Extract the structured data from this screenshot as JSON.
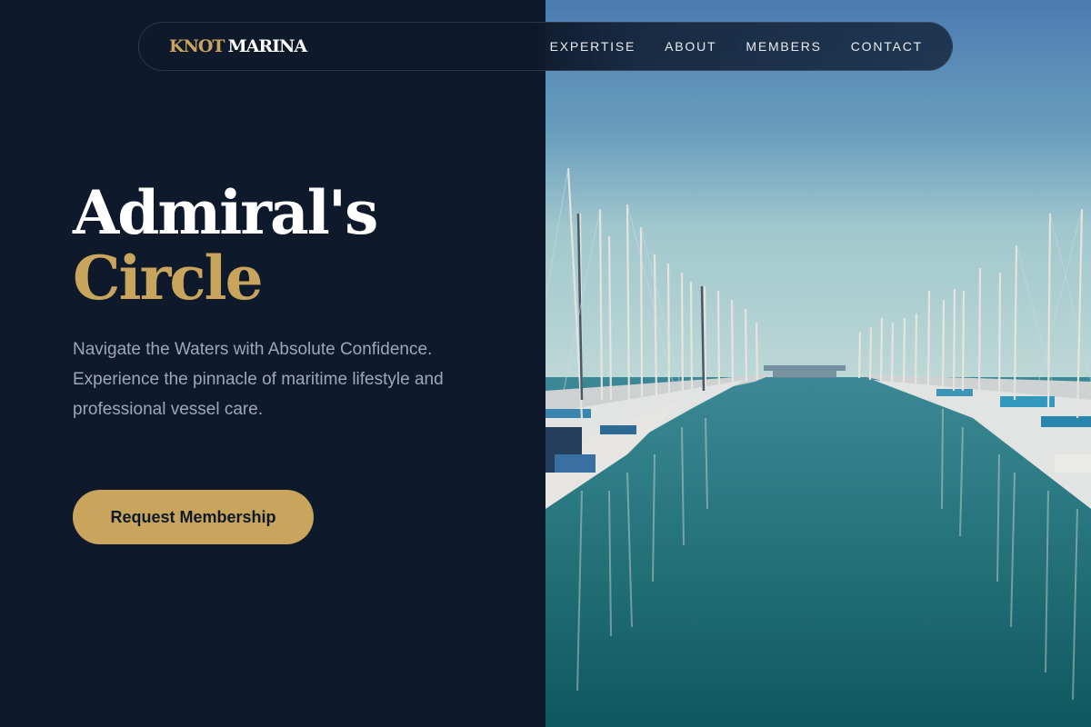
{
  "brand": {
    "part1": "KNOT",
    "part2": "MARINA"
  },
  "nav": {
    "items": [
      {
        "label": "EXPERTISE"
      },
      {
        "label": "ABOUT"
      },
      {
        "label": "MEMBERS"
      },
      {
        "label": "CONTACT"
      }
    ]
  },
  "hero": {
    "title_line1": "Admiral's",
    "title_line2": "Circle",
    "subtitle": "Navigate the Waters with Absolute Confidence. Experience the pinnacle of maritime lifestyle and professional vessel care.",
    "cta_label": "Request Membership"
  },
  "colors": {
    "background": "#0e1a2b",
    "accent": "#c9a45c",
    "text": "#ffffff",
    "muted": "#9aa8bc"
  },
  "image": {
    "alt": "marina-photo"
  }
}
